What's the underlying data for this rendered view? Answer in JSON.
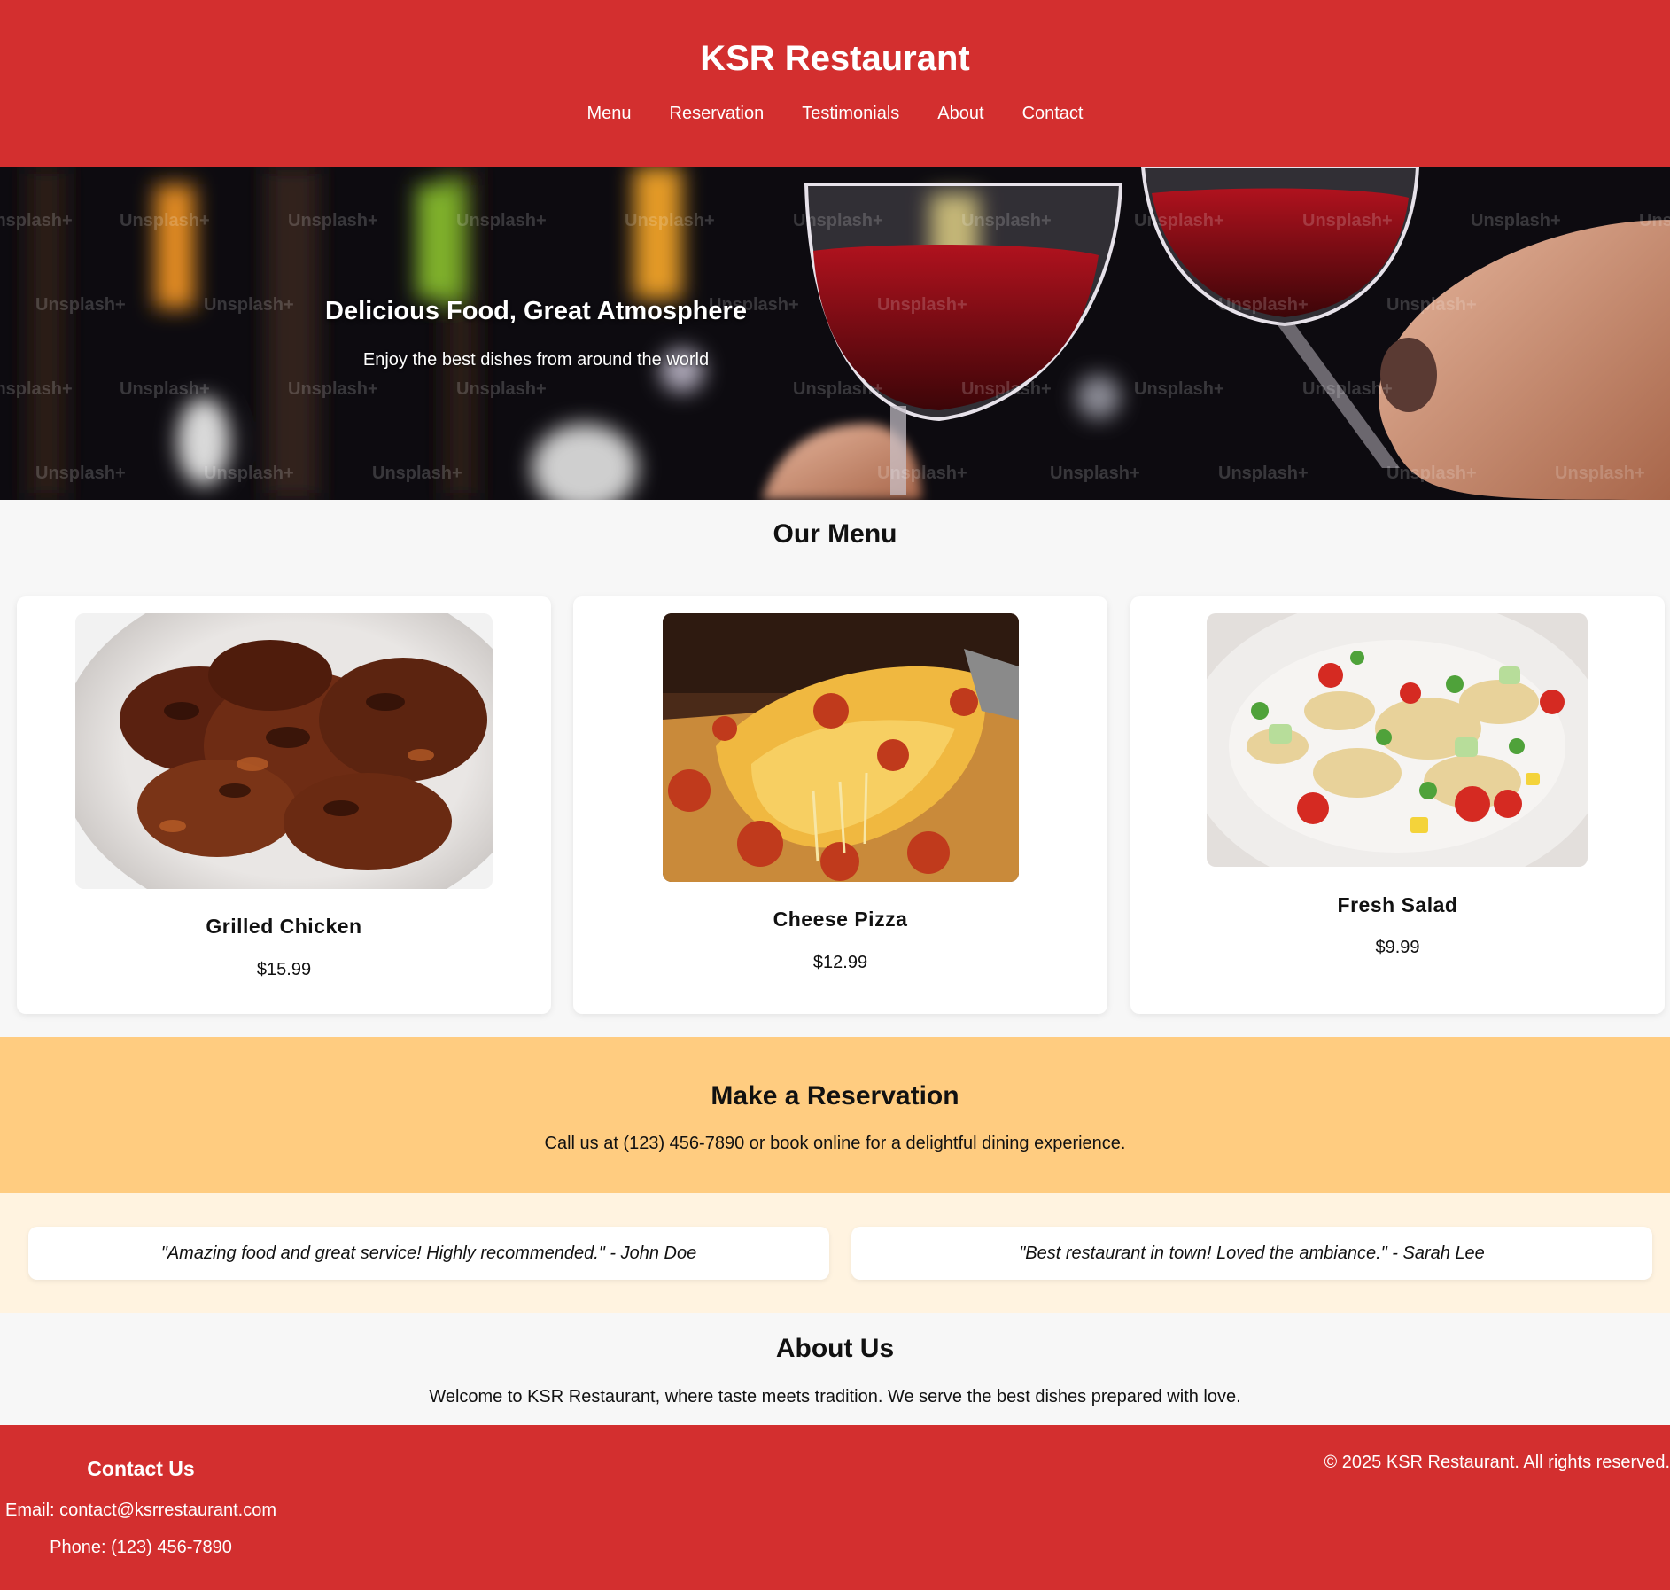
{
  "header": {
    "title": "KSR Restaurant",
    "nav": [
      "Menu",
      "Reservation",
      "Testimonials",
      "About",
      "Contact"
    ]
  },
  "hero": {
    "title": "Delicious Food, Great Atmosphere",
    "subtitle": "Enjoy the best dishes from around the world",
    "watermark": "Unsplash+"
  },
  "menu": {
    "title": "Our Menu",
    "items": [
      {
        "name": "Grilled Chicken",
        "price": "$15.99"
      },
      {
        "name": "Cheese Pizza",
        "price": "$12.99"
      },
      {
        "name": "Fresh Salad",
        "price": "$9.99"
      }
    ]
  },
  "reservation": {
    "title": "Make a Reservation",
    "text": "Call us at (123) 456-7890 or book online for a delightful dining experience."
  },
  "testimonials": [
    "\"Amazing food and great service! Highly recommended.\" - John Doe",
    "\"Best restaurant in town! Loved the ambiance.\" - Sarah Lee"
  ],
  "about": {
    "title": "About Us",
    "text": "Welcome to KSR Restaurant, where taste meets tradition. We serve the best dishes prepared with love."
  },
  "footer": {
    "contact_title": "Contact Us",
    "email": "Email: contact@ksrrestaurant.com",
    "phone": "Phone: (123) 456-7890",
    "copyright": "© 2025 KSR Restaurant. All rights reserved."
  },
  "colors": {
    "primary": "#d32f2f",
    "reservation_bg": "#ffcc80",
    "testimonials_bg": "#fff3e0",
    "page_bg": "#f7f7f7"
  }
}
